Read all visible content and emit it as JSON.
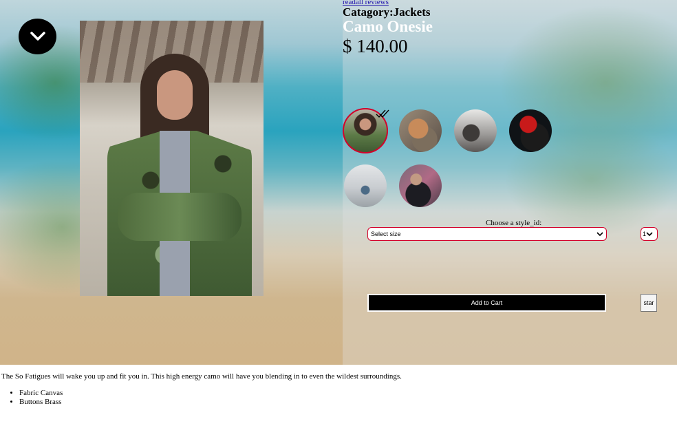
{
  "reviews": {
    "link_label": "readall reviews"
  },
  "product": {
    "category_label": "Catagory:",
    "category": "Jackets",
    "name": "Camo Onesie",
    "price": "$ 140.00"
  },
  "styles": {
    "label": "Choose a style_id:",
    "thumbnails": [
      {
        "name": "style-thumbnail-1",
        "selected": true
      },
      {
        "name": "style-thumbnail-2",
        "selected": false
      },
      {
        "name": "style-thumbnail-3",
        "selected": false
      },
      {
        "name": "style-thumbnail-4",
        "selected": false
      },
      {
        "name": "style-thumbnail-5",
        "selected": false
      },
      {
        "name": "style-thumbnail-6",
        "selected": false
      }
    ]
  },
  "size_select": {
    "value": "Select size"
  },
  "quantity_select": {
    "value": "1"
  },
  "actions": {
    "add_to_cart": "Add to Cart",
    "star": "star"
  },
  "description": {
    "text": "The So Fatigues will wake you up and fit you in. This high energy camo will have you blending in to even the wildest surroundings.",
    "features": [
      "Fabric Canvas",
      "Buttons Brass"
    ]
  },
  "colors": {
    "accent": "#d3002a",
    "button_bg": "#000000",
    "name_text": "#ffffff"
  },
  "icons": {
    "toggle": "chevron-down-icon",
    "selected": "checkmark-icon"
  }
}
